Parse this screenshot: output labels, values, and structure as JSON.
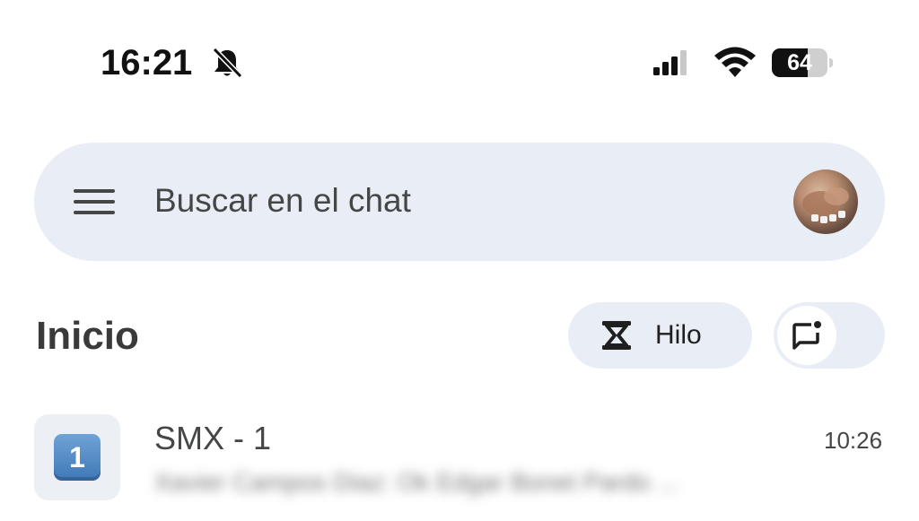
{
  "status_bar": {
    "time": "16:21",
    "battery_level": "64",
    "battery_fraction": 0.64,
    "icons": [
      "bell-off-icon",
      "cellular-signal-icon",
      "wifi-icon",
      "battery-icon"
    ]
  },
  "search": {
    "placeholder": "Buscar en el chat",
    "menu_icon": "hamburger-menu-icon",
    "avatar": "profile-avatar"
  },
  "header": {
    "title": "Inicio",
    "thread_button_label": "Hilo",
    "thread_icon": "hourglass-icon",
    "new_chat_icon": "new-chat-icon"
  },
  "chats": [
    {
      "title": "SMX - 1",
      "time": "10:26",
      "avatar_glyph": "1",
      "preview": "Xavier Campos Diaz: Ok  Edgar Bonet Pardo  ..."
    }
  ],
  "colors": {
    "accent_surface": "#e9eef6",
    "keycap_blue": "#3f78b8"
  }
}
